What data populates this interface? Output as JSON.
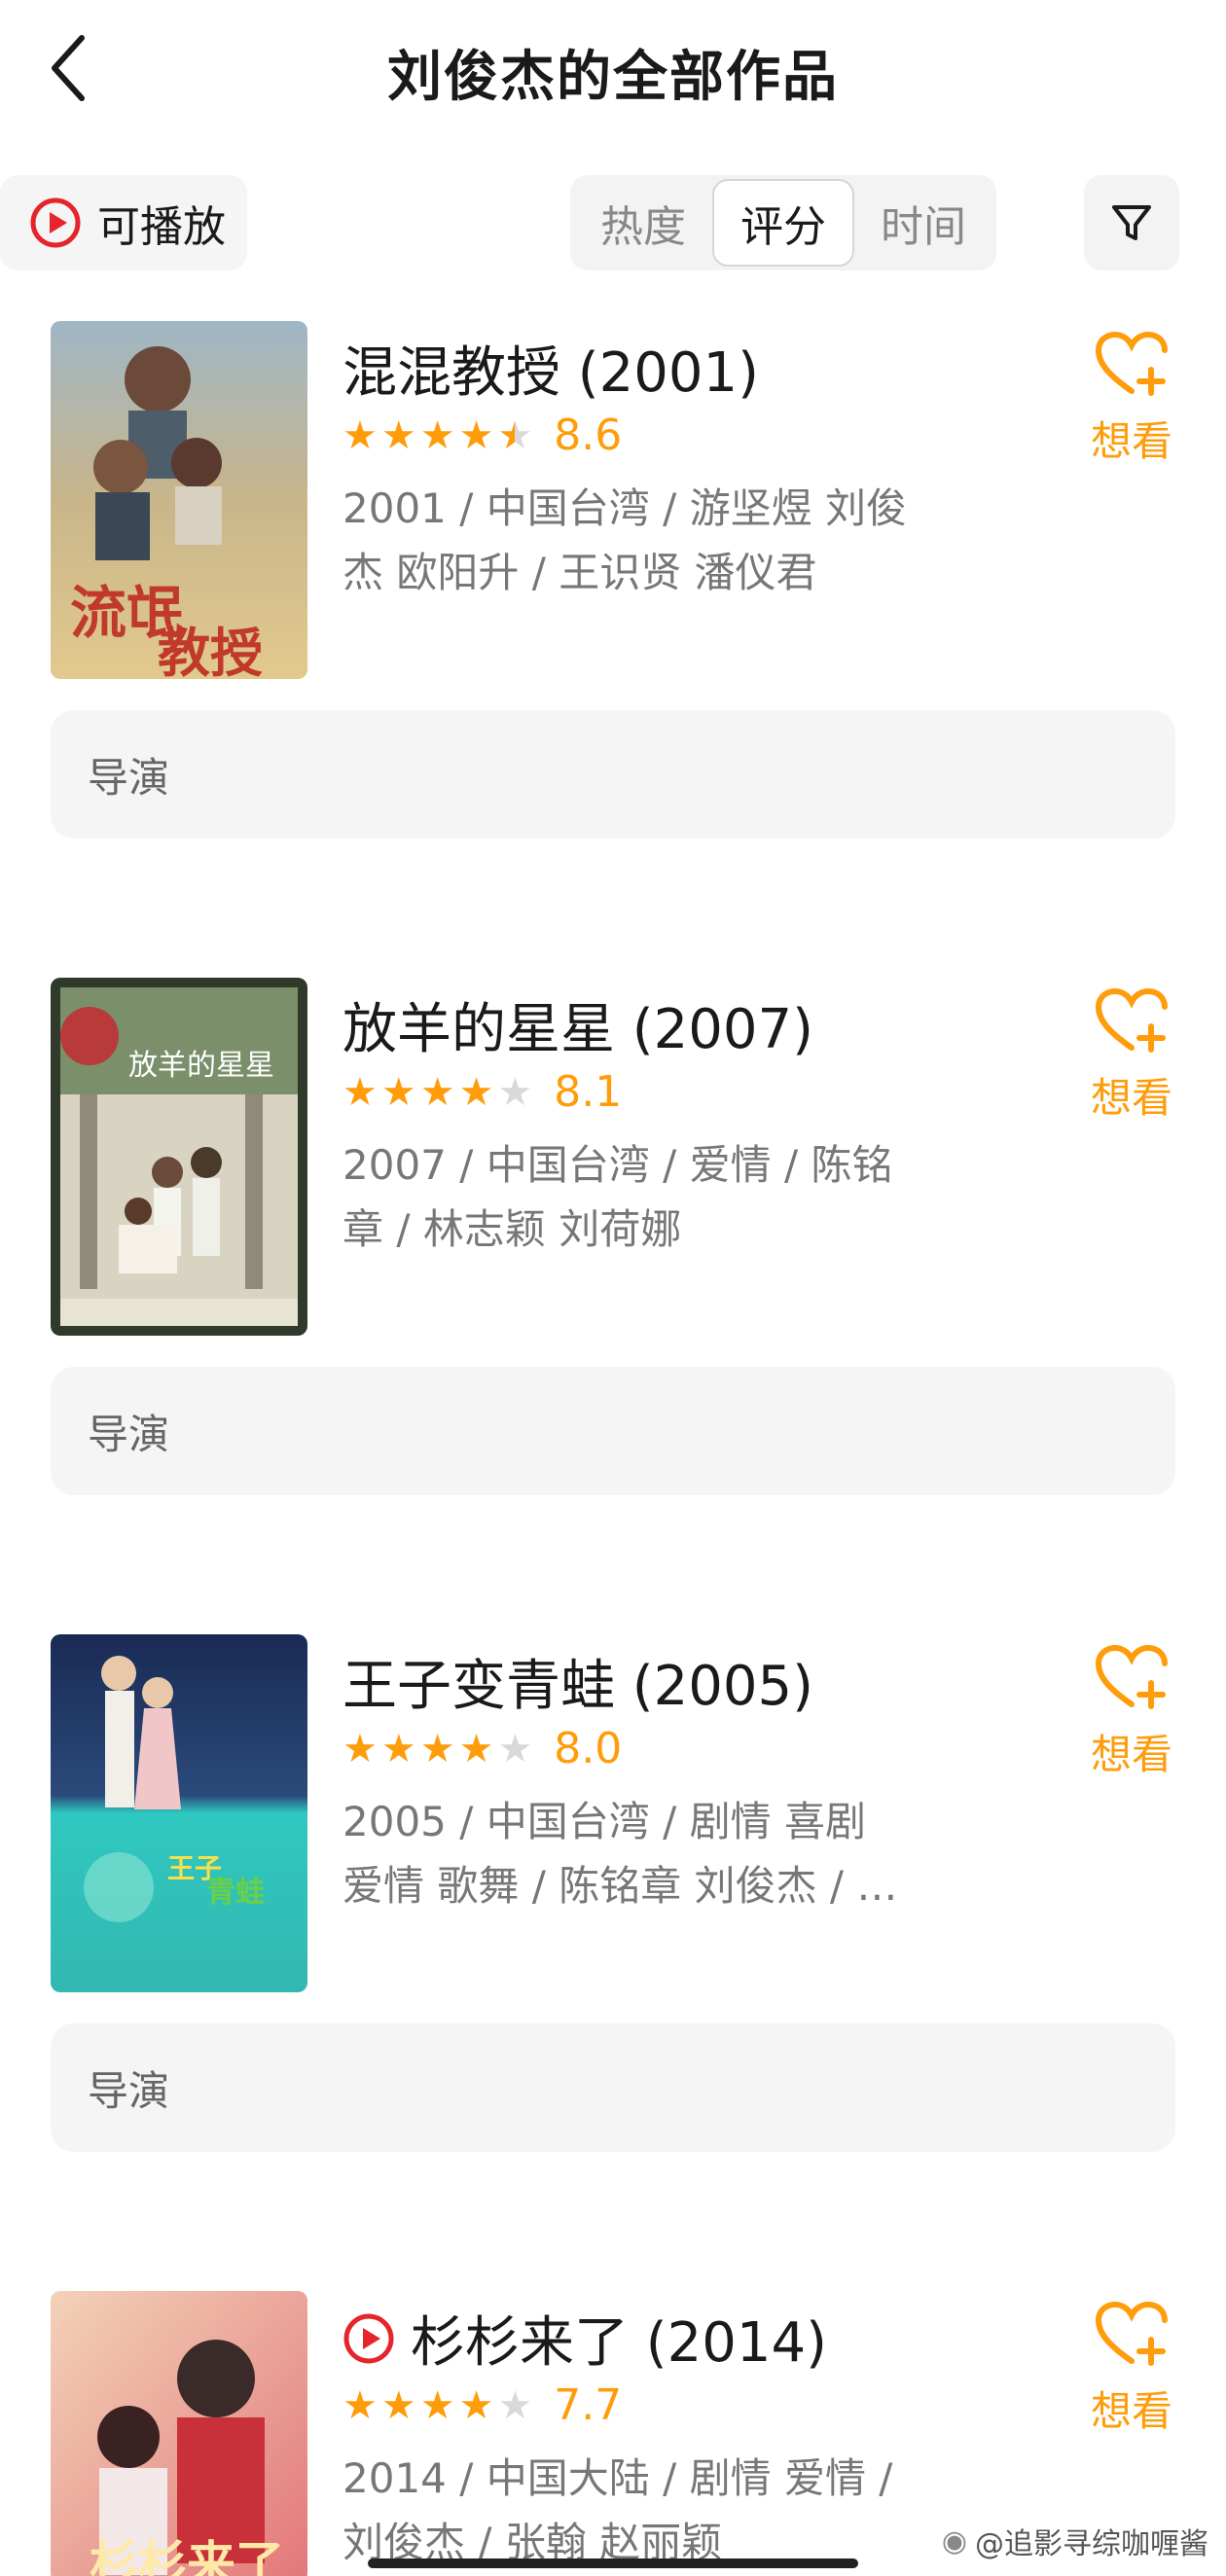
{
  "header": {
    "title": "刘俊杰的全部作品",
    "back_icon": "chevron-left-icon"
  },
  "filters": {
    "playable_label": "可播放",
    "sort_options": [
      "热度",
      "评分",
      "时间"
    ],
    "active_sort": "评分",
    "filter_icon": "funnel-icon"
  },
  "colors": {
    "accent": "#ff9c0a",
    "play_red": "#e5242b",
    "text_primary": "#1a1a1a",
    "text_secondary": "#777777",
    "panel_bg": "#f5f5f5"
  },
  "works": [
    {
      "title": "混混教授 (2001)",
      "playable": false,
      "stars": 4.5,
      "score": "8.6",
      "meta_line1": "2001 / 中国台湾 / 游坚煜 刘俊",
      "meta_line2": "杰 欧阳升 / 王识贤 潘仪君",
      "wish_label": "想看",
      "director_label": "导演"
    },
    {
      "title": "放羊的星星 (2007)",
      "playable": false,
      "stars": 4,
      "score": "8.1",
      "meta_line1": "2007 / 中国台湾 / 爱情 / 陈铭",
      "meta_line2": "章 / 林志颖 刘荷娜",
      "wish_label": "想看",
      "director_label": "导演"
    },
    {
      "title": "王子变青蛙 (2005)",
      "playable": false,
      "stars": 4,
      "score": "8.0",
      "meta_line1": "2005 / 中国台湾 / 剧情 喜剧",
      "meta_line2": "爱情 歌舞 / 陈铭章 刘俊杰 / …",
      "wish_label": "想看",
      "director_label": "导演"
    },
    {
      "title": "杉杉来了 (2014)",
      "playable": true,
      "stars": 4,
      "score": "7.7",
      "meta_line1": "2014 / 中国大陆 / 剧情 爱情 /",
      "meta_line2": "刘俊杰 / 张翰 赵丽颖",
      "wish_label": "想看",
      "director_label": ""
    }
  ],
  "watermark": "@追影寻综咖喱酱"
}
